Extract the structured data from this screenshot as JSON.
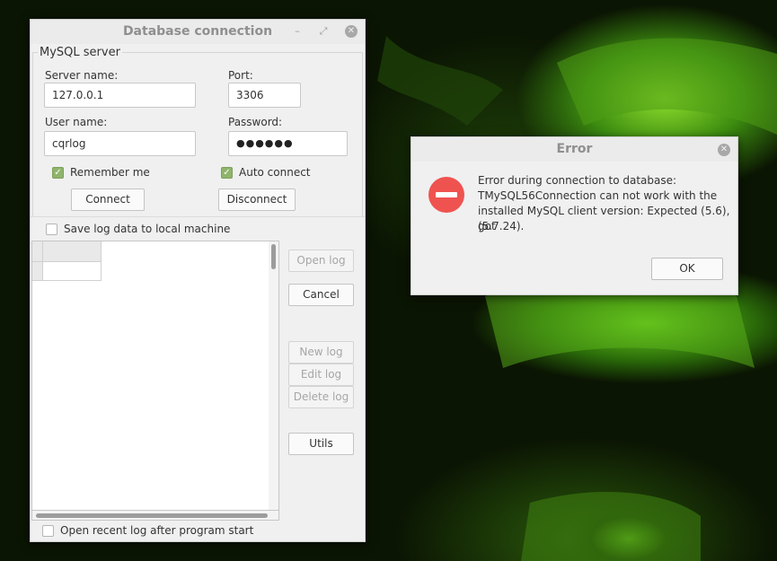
{
  "db_window": {
    "title": "Database connection",
    "group_title": "MySQL server",
    "server_name_label": "Server name:",
    "server_name_value": "127.0.0.1",
    "port_label": "Port:",
    "port_value": "3306",
    "user_name_label": "User name:",
    "user_name_value": "cqrlog",
    "password_label": "Password:",
    "password_value": "●●●●●●",
    "remember_me_label": "Remember me",
    "remember_me_checked": true,
    "auto_connect_label": "Auto connect",
    "auto_connect_checked": true,
    "connect_label": "Connect",
    "disconnect_label": "Disconnect",
    "save_local_label": "Save log data to local machine",
    "save_local_checked": false,
    "open_log_label": "Open log",
    "cancel_label": "Cancel",
    "new_log_label": "New log",
    "edit_log_label": "Edit log",
    "delete_log_label": "Delete log",
    "utils_label": "Utils",
    "open_recent_label": "Open recent log after program start",
    "open_recent_checked": false
  },
  "error_dialog": {
    "title": "Error",
    "message_lines": [
      "Error during connection to database:",
      "TMySQL56Connection can not work with the",
      "installed MySQL client version: Expected (5.6), got",
      "(5.7.24)."
    ],
    "ok_label": "OK"
  },
  "icons": {
    "minimize": "minimize-icon",
    "maximize": "maximize-icon",
    "close": "close-icon",
    "error": "error-icon",
    "check": "checkmark-icon"
  },
  "colors": {
    "error_red": "#ef5350",
    "check_green": "#8fb46c",
    "window_bg": "#f0f0f0"
  }
}
